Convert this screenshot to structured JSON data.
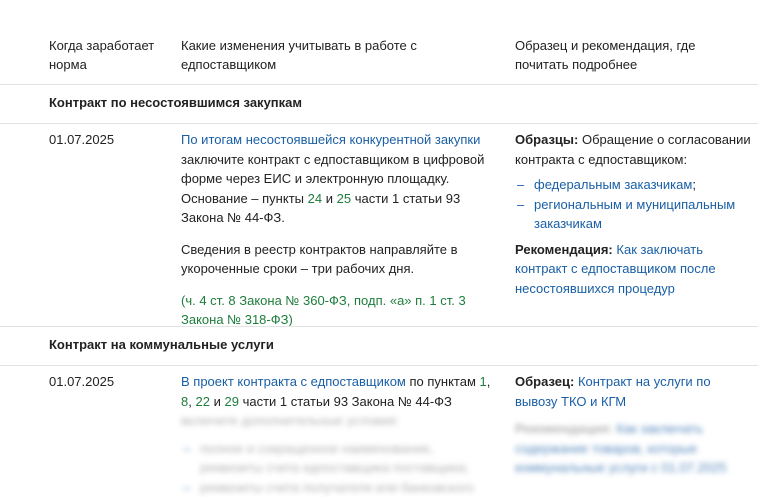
{
  "header": {
    "col1": "Когда заработает норма",
    "col2": "Какие изменения учитывать в работе с едпоставщиком",
    "col3": "Образец и рекомендация, где почитать подробнее"
  },
  "sections": [
    {
      "title": "Контракт по несостоявшимся закупкам",
      "date": "01.07.2025",
      "mid": {
        "link1": "По итогам несостоявшейся конкурентной закупки",
        "text1": "заключите контракт с едпоставщиком в цифровой форме через ЕИС и электронную площадку. Основание – пункты",
        "ref24": "24",
        "and": "и",
        "ref25": "25",
        "text2": "части 1 статьи 93 Закона № 44-ФЗ.",
        "para2": "Сведения в реестр контрактов направляйте в укороченные сроки – три рабочих дня.",
        "src_open": "(",
        "src1": "ч. 4 ст. 8 Закона № 360-ФЗ",
        "src_sep": ",",
        "src2": "подп. «а» п. 1 ст. 3 Закона № 318-ФЗ",
        "src_close": ")"
      },
      "right": {
        "samples_label": "Образцы:",
        "samples_text": "Обращение о согласовании контракта с едпоставщиком:",
        "items": [
          "федеральным заказчикам",
          "региональным и муниципальным заказчикам"
        ],
        "item1_suffix": ";",
        "rec_label": "Рекомендация:",
        "rec_link": "Как заключать контракт с едпоставщиком после несостоявшихся процедур"
      }
    },
    {
      "title": "Контракт на коммунальные услуги",
      "date": "01.07.2025",
      "mid": {
        "link1": "В проект контракта с едпоставщиком",
        "t1": "по пунктам",
        "r1": "1",
        "c1": ",",
        "r8": "8",
        "c2": ",",
        "r22": "22",
        "and": "и",
        "r29": "29",
        "t2": "части 1 статьи 93 Закона № 44-ФЗ",
        "blur1": "включите дополнительные условия:",
        "blur2": "полное и сокращенное наименование, реквизиты счета едпоставщика поставщика;",
        "blur3": "реквизиты счета получателя или банковского"
      },
      "right": {
        "sample_label": "Образец:",
        "sample_link": "Контракт на услуги по вывозу ТКО и КГМ",
        "blur_label": "Рекомендация:",
        "blur_link": "Как заключать содержание товаров, которые коммунальные услуги с 01.07.2025"
      }
    }
  ]
}
